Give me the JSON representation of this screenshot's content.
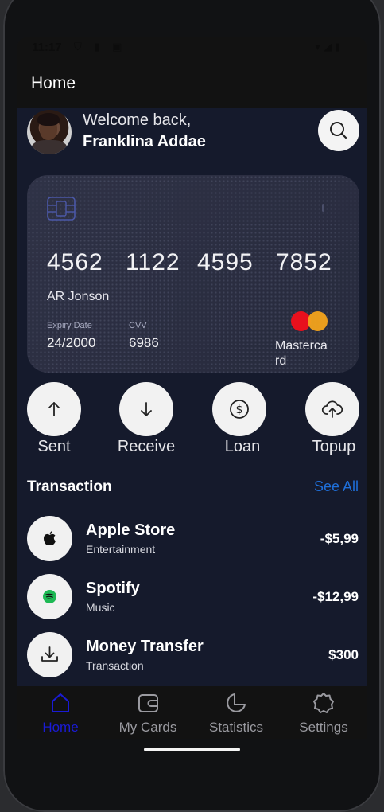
{
  "status_bar": {
    "time": "11:17",
    "left_icons": "⛉ ▮ ▣",
    "right_icons": "▾◢▮"
  },
  "appbar": {
    "title": "Home"
  },
  "user": {
    "welcome": "Welcome back,",
    "name": "Franklina Addae"
  },
  "card": {
    "number_groups": [
      "4562",
      "1122",
      "4595",
      "7852"
    ],
    "holder": "AR Jonson",
    "expiry_label": "Expiry Date",
    "expiry_value": "24/2000",
    "cvv_label": "CVV",
    "cvv_value": "6986",
    "network": "Mastercard",
    "colors": {
      "mc_red": "#e8101d",
      "mc_yellow": "#f3a31b"
    }
  },
  "actions": [
    {
      "label": "Sent",
      "icon": "arrow-up-icon"
    },
    {
      "label": "Receive",
      "icon": "arrow-down-icon"
    },
    {
      "label": "Loan",
      "icon": "dollar-circle-icon"
    },
    {
      "label": "Topup",
      "icon": "cloud-upload-icon"
    }
  ],
  "transactions_section": {
    "title": "Transaction",
    "see_all": "See All"
  },
  "transactions": [
    {
      "title": "Apple Store",
      "subtitle": "Entertainment",
      "amount": "-$5,99",
      "icon": "apple-icon"
    },
    {
      "title": "Spotify",
      "subtitle": "Music",
      "amount": "-$12,99",
      "icon": "spotify-icon"
    },
    {
      "title": "Money Transfer",
      "subtitle": "Transaction",
      "amount": "$300",
      "icon": "download-icon"
    }
  ],
  "bottom_nav": [
    {
      "label": "Home",
      "icon": "home-icon",
      "active": true
    },
    {
      "label": "My Cards",
      "icon": "wallet-icon",
      "active": false
    },
    {
      "label": "Statistics",
      "icon": "pie-chart-icon",
      "active": false
    },
    {
      "label": "Settings",
      "icon": "gear-icon",
      "active": false
    }
  ],
  "colors": {
    "accent_link": "#1f6fd9",
    "nav_active": "#1a1bd6",
    "background": "#151a2c"
  }
}
